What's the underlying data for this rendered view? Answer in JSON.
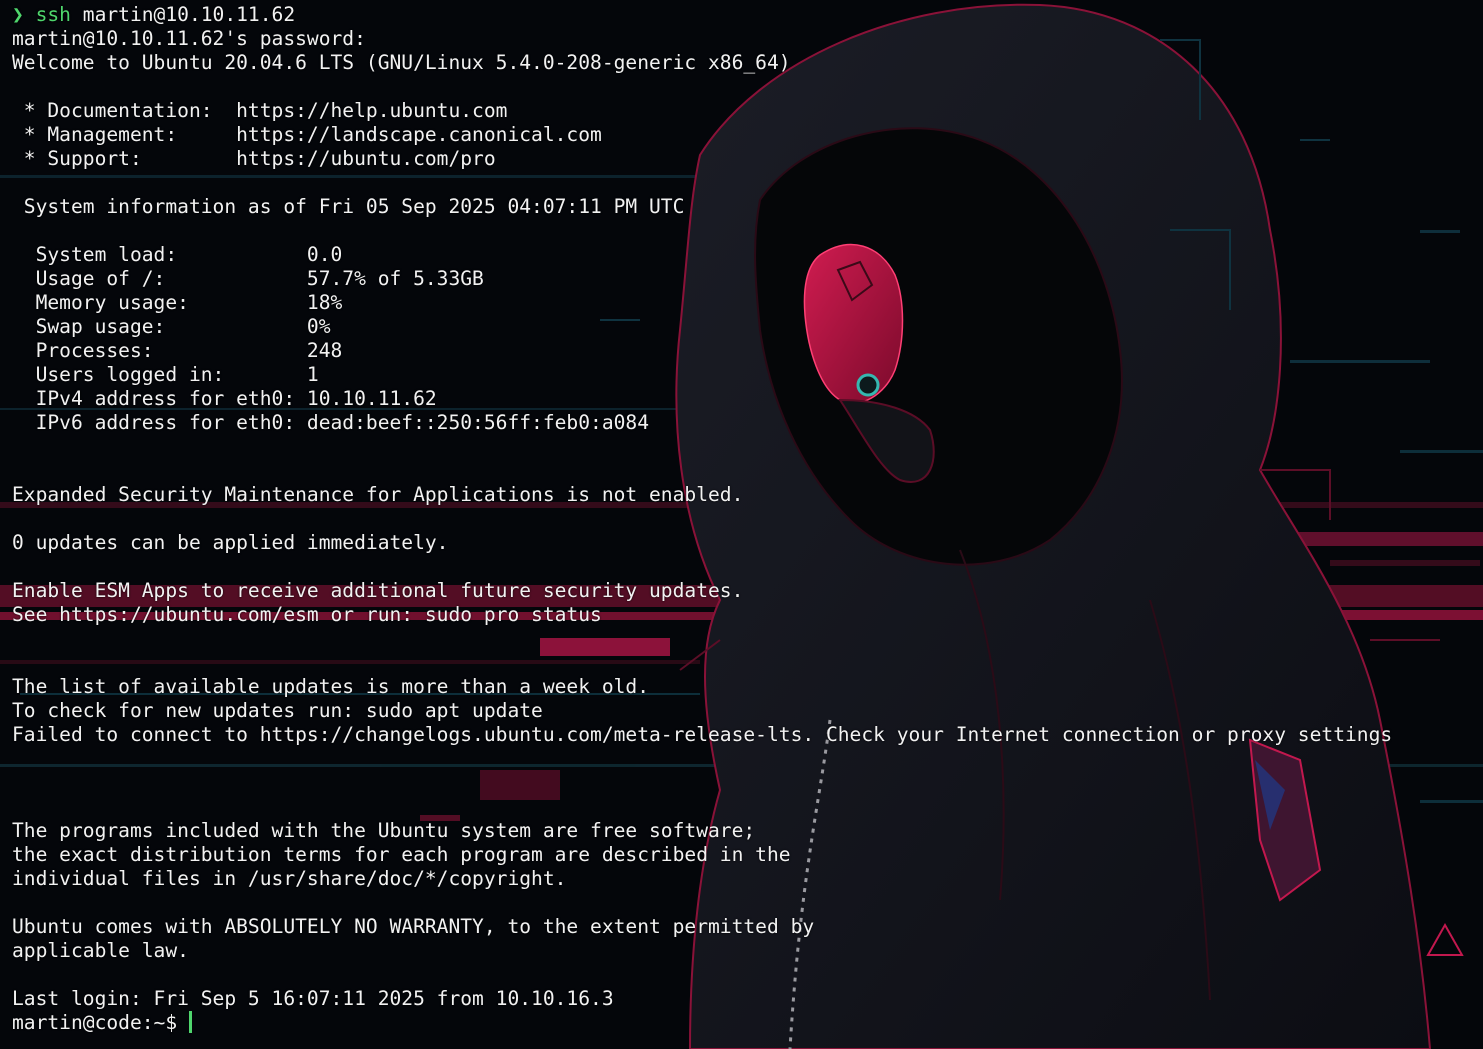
{
  "colors": {
    "background": "#04060a",
    "text": "#f2f2f2",
    "prompt_green": "#4fd66d",
    "accent_pink": "#c2184e",
    "accent_cyan": "#1fa7b8"
  },
  "wallpaper": {
    "icon": "hooded-figure-wallpaper"
  },
  "session": {
    "prompt_symbol": "❯",
    "command_name": "ssh",
    "command_args": " martin@10.10.11.62",
    "lines": [
      "martin@10.10.11.62's password:",
      "Welcome to Ubuntu 20.04.6 LTS (GNU/Linux 5.4.0-208-generic x86_64)",
      "",
      " * Documentation:  https://help.ubuntu.com",
      " * Management:     https://landscape.canonical.com",
      " * Support:        https://ubuntu.com/pro",
      "",
      " System information as of Fri 05 Sep 2025 04:07:11 PM UTC",
      "",
      "  System load:           0.0",
      "  Usage of /:            57.7% of 5.33GB",
      "  Memory usage:          18%",
      "  Swap usage:            0%",
      "  Processes:             248",
      "  Users logged in:       1",
      "  IPv4 address for eth0: 10.10.11.62",
      "  IPv6 address for eth0: dead:beef::250:56ff:feb0:a084",
      "",
      "",
      "Expanded Security Maintenance for Applications is not enabled.",
      "",
      "0 updates can be applied immediately.",
      "",
      "Enable ESM Apps to receive additional future security updates.",
      "See https://ubuntu.com/esm or run: sudo pro status",
      "",
      "",
      "The list of available updates is more than a week old.",
      "To check for new updates run: sudo apt update",
      "Failed to connect to https://changelogs.ubuntu.com/meta-release-lts. Check your Internet connection or proxy settings",
      "",
      "",
      "",
      "The programs included with the Ubuntu system are free software;",
      "the exact distribution terms for each program are described in the",
      "individual files in /usr/share/doc/*/copyright.",
      "",
      "Ubuntu comes with ABSOLUTELY NO WARRANTY, to the extent permitted by",
      "applicable law.",
      "",
      "Last login: Fri Sep 5 16:07:11 2025 from 10.10.16.3"
    ],
    "current_prompt": "martin@code:~$"
  }
}
